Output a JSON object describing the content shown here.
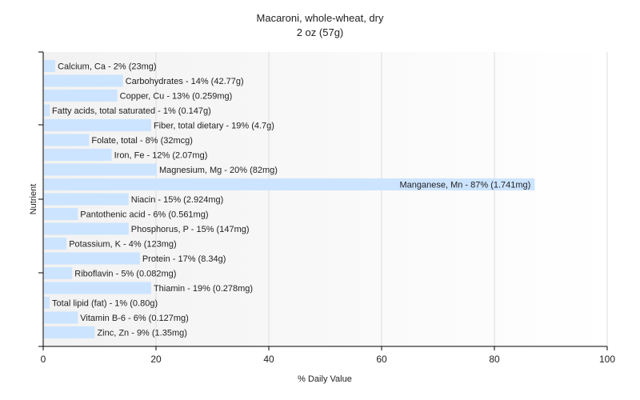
{
  "chart_data": {
    "type": "bar",
    "orientation": "horizontal",
    "title": "Macaroni, whole-wheat, dry",
    "subtitle": "2 oz (57g)",
    "xlabel": "% Daily Value",
    "ylabel": "Nutrient",
    "xlim": [
      0,
      100
    ],
    "xticks": [
      0,
      20,
      40,
      60,
      80,
      100
    ],
    "grid": true,
    "bar_color": "#cce4ff",
    "categories": [
      "Calcium, Ca - 2% (23mg)",
      "Carbohydrates - 14% (42.77g)",
      "Copper, Cu - 13% (0.259mg)",
      "Fatty acids, total saturated - 1% (0.147g)",
      "Fiber, total dietary - 19% (4.7g)",
      "Folate, total - 8% (32mcg)",
      "Iron, Fe - 12% (2.07mg)",
      "Magnesium, Mg - 20% (82mg)",
      "Manganese, Mn - 87% (1.741mg)",
      "Niacin - 15% (2.924mg)",
      "Pantothenic acid - 6% (0.561mg)",
      "Phosphorus, P - 15% (147mg)",
      "Potassium, K - 4% (123mg)",
      "Protein - 17% (8.34g)",
      "Riboflavin - 5% (0.082mg)",
      "Thiamin - 19% (0.278mg)",
      "Total lipid (fat) - 1% (0.80g)",
      "Vitamin B-6 - 6% (0.127mg)",
      "Zinc, Zn - 9% (1.35mg)"
    ],
    "values": [
      2,
      14,
      13,
      1,
      19,
      8,
      12,
      20,
      87,
      15,
      6,
      15,
      4,
      17,
      5,
      19,
      1,
      6,
      9
    ]
  }
}
